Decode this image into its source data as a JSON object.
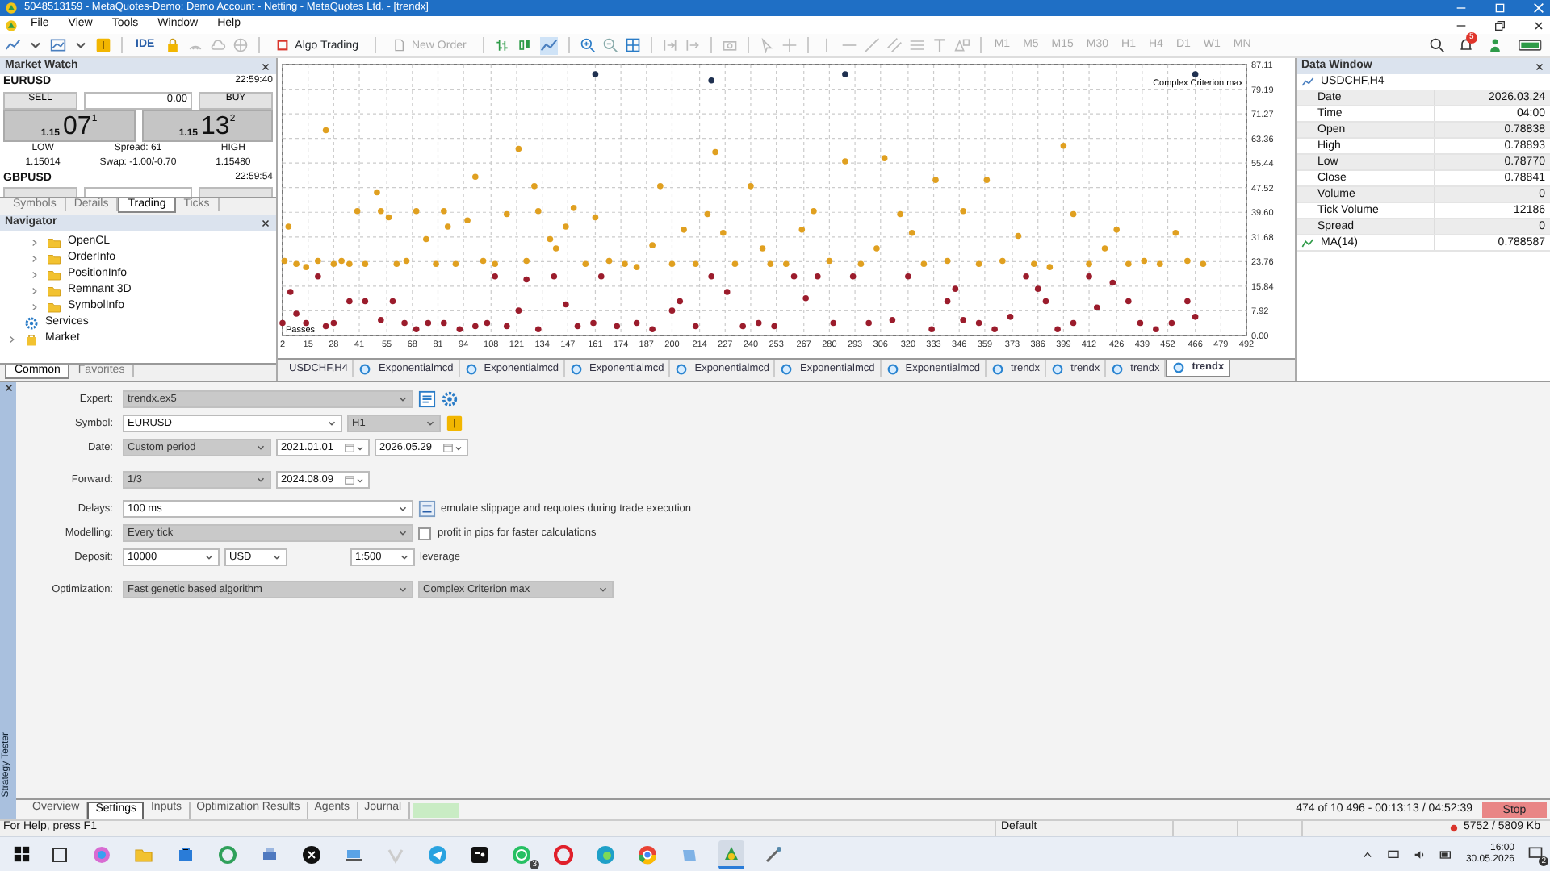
{
  "window": {
    "title": "5048513159 - MetaQuotes-Demo: Demo Account - Netting - MetaQuotes Ltd. - [trendx]"
  },
  "menu": [
    "File",
    "View",
    "Tools",
    "Window",
    "Help"
  ],
  "toolbar": {
    "ide": "IDE",
    "algo_trading": {
      "label": "Algo Trading",
      "on": false
    },
    "new_order": {
      "label": "New Order",
      "disabled": true
    },
    "timeframes": {
      "disabled": true,
      "items": [
        "M1",
        "M5",
        "M15",
        "M30",
        "H1",
        "H4",
        "D1",
        "W1",
        "MN"
      ]
    },
    "notifications_badge": "5"
  },
  "market_watch": {
    "title": "Market Watch",
    "symbols": [
      {
        "symbol": "EURUSD",
        "time": "22:59:40",
        "sell": "SELL",
        "volume": "0.00",
        "buy": "BUY",
        "bid": {
          "prefix": "1.15",
          "big": "07",
          "sup": "1"
        },
        "ask": {
          "prefix": "1.15",
          "big": "13",
          "sup": "2"
        },
        "low_label": "LOW",
        "spread": "Spread: 61",
        "high_label": "HIGH",
        "low": "1.15014",
        "swap": "Swap: -1.00/-0.70",
        "high": "1.15480"
      },
      {
        "symbol": "GBPUSD",
        "time": "22:59:54"
      }
    ],
    "tabs": [
      {
        "label": "Symbols",
        "selected": false
      },
      {
        "label": "Details",
        "selected": false
      },
      {
        "label": "Trading",
        "selected": true
      },
      {
        "label": "Ticks",
        "selected": false
      }
    ]
  },
  "navigator": {
    "title": "Navigator",
    "tree": [
      {
        "kind": "group",
        "children": [
          {
            "label": "OpenCL",
            "kind": "folder",
            "expanded": false
          },
          {
            "label": "OrderInfo",
            "kind": "folder",
            "expanded": false
          },
          {
            "label": "PositionInfo",
            "kind": "folder",
            "expanded": false
          },
          {
            "label": "Remnant 3D",
            "kind": "folder",
            "expanded": false
          },
          {
            "label": "SymbolInfo",
            "kind": "folder",
            "expanded": false
          }
        ]
      },
      {
        "label": "Services",
        "kind": "services"
      },
      {
        "label": "Market",
        "kind": "market",
        "expanded": false
      }
    ],
    "tabs": [
      {
        "label": "Common",
        "selected": true
      },
      {
        "label": "Favorites",
        "selected": false
      }
    ]
  },
  "chart": {
    "criterion_label": "Complex Criterion max",
    "passes_label": "Passes",
    "chart_data": {
      "type": "scatter",
      "xlim": [
        2,
        492
      ],
      "ylim": [
        0,
        87.11
      ],
      "xticks": [
        2,
        15,
        28,
        41,
        55,
        68,
        81,
        94,
        108,
        121,
        134,
        147,
        161,
        174,
        187,
        200,
        214,
        227,
        240,
        253,
        267,
        280,
        293,
        306,
        320,
        333,
        346,
        359,
        373,
        386,
        399,
        412,
        426,
        439,
        452,
        466,
        479,
        492
      ],
      "yticks": [
        {
          "value": 0,
          "label": "0.00"
        },
        {
          "value": 7.92,
          "label": "7.92"
        },
        {
          "value": 15.84,
          "label": "15.84"
        },
        {
          "value": 23.76,
          "label": "23.76"
        },
        {
          "value": 31.68,
          "label": "31.68"
        },
        {
          "value": 39.6,
          "label": "39.60"
        },
        {
          "value": 47.52,
          "label": "47.52"
        },
        {
          "value": 55.44,
          "label": "55.44"
        },
        {
          "value": 63.36,
          "label": "63.36"
        },
        {
          "value": 71.27,
          "label": "71.27"
        },
        {
          "value": 79.19,
          "label": "79.19"
        },
        {
          "value": 87.11,
          "label": "87.11"
        }
      ],
      "series": [
        {
          "color": "#e0a020",
          "x": [
            3,
            5,
            9,
            14,
            20,
            24,
            28,
            32,
            36,
            40,
            44,
            50,
            52,
            56,
            60,
            65,
            70,
            75,
            80,
            84,
            86,
            90,
            96,
            100,
            104,
            110,
            116,
            122,
            126,
            130,
            132,
            138,
            141,
            146,
            150,
            156,
            161,
            168,
            176,
            182,
            190,
            194,
            200,
            206,
            212,
            218,
            222,
            226,
            232,
            240,
            246,
            250,
            258,
            266,
            272,
            280,
            288,
            296,
            304,
            308,
            316,
            322,
            328,
            334,
            340,
            348,
            356,
            360,
            368,
            376,
            384,
            392,
            399,
            404,
            412,
            420,
            426,
            432,
            440,
            448,
            456,
            462,
            470
          ],
          "values": [
            24,
            35,
            23,
            22,
            24,
            66,
            23,
            24,
            23,
            40,
            23,
            46,
            40,
            38,
            23,
            24,
            40,
            31,
            23,
            40,
            35,
            23,
            37,
            51,
            24,
            23,
            39,
            60,
            24,
            48,
            40,
            31,
            28,
            35,
            41,
            23,
            38,
            24,
            23,
            22,
            29,
            48,
            23,
            34,
            23,
            39,
            59,
            33,
            23,
            48,
            28,
            23,
            23,
            34,
            40,
            24,
            56,
            23,
            28,
            57,
            39,
            33,
            23,
            50,
            24,
            40,
            23,
            50,
            24,
            32,
            23,
            22,
            61,
            39,
            23,
            28,
            34,
            23,
            24,
            23,
            33,
            24,
            23
          ]
        },
        {
          "color": "#9b1c2c",
          "x": [
            2,
            6,
            9,
            14,
            20,
            24,
            28,
            36,
            44,
            52,
            58,
            64,
            70,
            76,
            84,
            92,
            100,
            106,
            110,
            116,
            122,
            126,
            132,
            140,
            146,
            152,
            160,
            164,
            172,
            182,
            190,
            200,
            204,
            212,
            220,
            228,
            236,
            244,
            252,
            262,
            268,
            274,
            282,
            292,
            300,
            312,
            320,
            332,
            340,
            344,
            348,
            356,
            364,
            372,
            380,
            386,
            390,
            396,
            404,
            412,
            416,
            424,
            432,
            438,
            446,
            454,
            462,
            466
          ],
          "values": [
            4,
            14,
            7,
            4,
            19,
            3,
            4,
            11,
            11,
            5,
            11,
            4,
            2,
            4,
            4,
            2,
            3,
            4,
            19,
            3,
            8,
            18,
            2,
            19,
            10,
            3,
            4,
            19,
            3,
            4,
            2,
            8,
            11,
            3,
            19,
            14,
            3,
            4,
            3,
            19,
            12,
            19,
            4,
            19,
            4,
            5,
            19,
            2,
            11,
            15,
            5,
            4,
            2,
            6,
            19,
            15,
            11,
            2,
            4,
            19,
            9,
            17,
            11,
            4,
            2,
            4,
            11,
            6
          ]
        },
        {
          "color": "#1f3050",
          "x": [
            161,
            220,
            288,
            466
          ],
          "values": [
            84,
            82,
            84,
            84
          ]
        }
      ],
      "grid": true
    },
    "tabs": [
      {
        "label": "USDCHF,H4",
        "kind": "chart",
        "selected": false
      },
      {
        "label": "Exponentialmcd",
        "kind": "optimization",
        "selected": false
      },
      {
        "label": "Exponentialmcd",
        "kind": "optimization",
        "selected": false
      },
      {
        "label": "Exponentialmcd",
        "kind": "optimization",
        "selected": false
      },
      {
        "label": "Exponentialmcd",
        "kind": "optimization",
        "selected": false
      },
      {
        "label": "Exponentialmcd",
        "kind": "optimization",
        "selected": false
      },
      {
        "label": "Exponentialmcd",
        "kind": "optimization",
        "selected": false
      },
      {
        "label": "trendx",
        "kind": "optimization",
        "selected": false
      },
      {
        "label": "trendx",
        "kind": "optimization",
        "selected": false
      },
      {
        "label": "trendx",
        "kind": "optimization",
        "selected": false
      },
      {
        "label": "trendx",
        "kind": "optimization",
        "selected": true
      }
    ]
  },
  "data_window": {
    "title": "Data Window",
    "symbol": "USDCHF,H4",
    "rows": [
      {
        "label": "Date",
        "value": "2026.03.24",
        "kind": "field"
      },
      {
        "label": "Time",
        "value": "04:00",
        "kind": "field"
      },
      {
        "label": "Open",
        "value": "0.78838",
        "kind": "field"
      },
      {
        "label": "High",
        "value": "0.78893",
        "kind": "field"
      },
      {
        "label": "Low",
        "value": "0.78770",
        "kind": "field"
      },
      {
        "label": "Close",
        "value": "0.78841",
        "kind": "field"
      },
      {
        "label": "Volume",
        "value": "0",
        "kind": "field"
      },
      {
        "label": "Tick Volume",
        "value": "12186",
        "kind": "field"
      },
      {
        "label": "Spread",
        "value": "0",
        "kind": "field"
      },
      {
        "label": "MA(14)",
        "value": "0.788587",
        "kind": "indicator"
      }
    ]
  },
  "strategy_tester": {
    "title": "Strategy Tester",
    "rows": [
      {
        "label": "Expert:",
        "controls": [
          {
            "kind": "select",
            "value": "trendx.ex5",
            "disabled": true
          },
          {
            "kind": "ide-button"
          },
          {
            "kind": "settings-button"
          }
        ]
      },
      {
        "label": "Symbol:",
        "controls": [
          {
            "kind": "select",
            "value": "EURUSD",
            "disabled": false
          },
          {
            "kind": "select",
            "value": "H1",
            "disabled": true
          },
          {
            "kind": "symbol-button"
          }
        ]
      },
      {
        "label": "Date:",
        "controls": [
          {
            "kind": "select",
            "value": "Custom period",
            "disabled": true
          },
          {
            "kind": "date",
            "value": "2021.01.01"
          },
          {
            "kind": "date",
            "value": "2026.05.29"
          }
        ]
      },
      {
        "label": "Forward:",
        "controls": [
          {
            "kind": "select",
            "value": "1/3",
            "disabled": true
          },
          {
            "kind": "date",
            "value": "2024.08.09"
          }
        ]
      },
      {
        "label": "Delays:",
        "controls": [
          {
            "kind": "select",
            "value": "100 ms",
            "disabled": false
          },
          {
            "kind": "delays-button"
          },
          {
            "kind": "text",
            "value": "emulate slippage and requotes during trade execution"
          }
        ]
      },
      {
        "label": "Modelling:",
        "controls": [
          {
            "kind": "select",
            "value": "Every tick",
            "disabled": true
          },
          {
            "kind": "checkbox",
            "value": "profit in pips for faster calculations",
            "checked": false
          }
        ]
      },
      {
        "label": "Deposit:",
        "controls": [
          {
            "kind": "select",
            "value": "10000",
            "disabled": false
          },
          {
            "kind": "select",
            "value": "USD",
            "disabled": false
          },
          {
            "kind": "select",
            "value": "1:500",
            "disabled": false
          },
          {
            "kind": "text",
            "value": "leverage"
          }
        ]
      },
      {
        "label": "Optimization:",
        "controls": [
          {
            "kind": "select",
            "value": "Fast genetic based algorithm",
            "disabled": true
          },
          {
            "kind": "select",
            "value": "Complex Criterion max",
            "disabled": true
          }
        ]
      }
    ],
    "tabs": [
      {
        "label": "Overview",
        "selected": false
      },
      {
        "label": "Settings",
        "selected": true
      },
      {
        "label": "Inputs",
        "selected": false
      },
      {
        "label": "Optimization Results",
        "selected": false
      },
      {
        "label": "Agents",
        "selected": false
      },
      {
        "label": "Journal",
        "selected": false
      }
    ],
    "progress": {
      "level": 1
    },
    "status": "474 of 10 496 - 00:13:13 / 04:52:39",
    "stop": "Stop"
  },
  "status_bar": {
    "help": "For Help, press F1",
    "profile": "Default",
    "memory": "5752 / 5809 Kb"
  },
  "taskbar": {
    "apps": [
      {
        "kind": "task-view",
        "selected": false
      },
      {
        "kind": "copilot",
        "selected": false
      },
      {
        "kind": "folder",
        "selected": false
      },
      {
        "kind": "store",
        "selected": false
      },
      {
        "kind": "sync",
        "selected": false
      },
      {
        "kind": "printer",
        "selected": false
      },
      {
        "kind": "x",
        "selected": false
      },
      {
        "kind": "laptop",
        "selected": false
      },
      {
        "kind": "vee",
        "selected": false
      },
      {
        "kind": "telegram",
        "selected": false
      },
      {
        "kind": "tv",
        "selected": false
      },
      {
        "kind": "whatsapp",
        "selected": false,
        "badge": "3"
      },
      {
        "kind": "opera",
        "selected": false
      },
      {
        "kind": "edge",
        "selected": false
      },
      {
        "kind": "chrome",
        "selected": false
      },
      {
        "kind": "notes",
        "selected": false
      },
      {
        "kind": "metatrader",
        "selected": true
      },
      {
        "kind": "brush",
        "selected": false
      }
    ],
    "time": "16:00",
    "date": "30.05.2026",
    "notification_count": "2"
  }
}
